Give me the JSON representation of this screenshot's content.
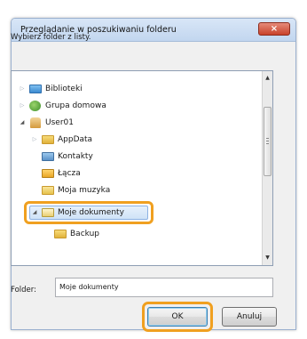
{
  "dialog": {
    "title": "Przeglądanie w poszukiwaniu folderu",
    "close_glyph": "×",
    "instruction": "Wybierz folder z listy."
  },
  "tree": {
    "items": [
      {
        "label": "Biblioteki",
        "icon": "library-icon",
        "state": "collapsed"
      },
      {
        "label": "Grupa domowa",
        "icon": "homegroup-icon",
        "state": "collapsed"
      },
      {
        "label": "User01",
        "icon": "user-icon",
        "state": "expanded"
      },
      {
        "label": "AppData",
        "icon": "folder-icon",
        "state": "collapsed"
      },
      {
        "label": "Kontakty",
        "icon": "contacts-icon",
        "state": "none"
      },
      {
        "label": "Łącza",
        "icon": "links-icon",
        "state": "none"
      },
      {
        "label": "Moja muzyka",
        "icon": "music-folder-icon",
        "state": "none"
      },
      {
        "label": "Moje dokumenty",
        "icon": "documents-icon",
        "state": "expanded",
        "selected": true
      },
      {
        "label": "Backup",
        "icon": "folder-icon",
        "state": "none"
      }
    ]
  },
  "folder_field": {
    "label": "Folder:",
    "value": "Moje dokumenty"
  },
  "buttons": {
    "ok": "OK",
    "cancel": "Anuluj"
  },
  "colors": {
    "highlight": "#f0a020",
    "selection": "#cfe3f7",
    "close_button": "#c9422a"
  }
}
